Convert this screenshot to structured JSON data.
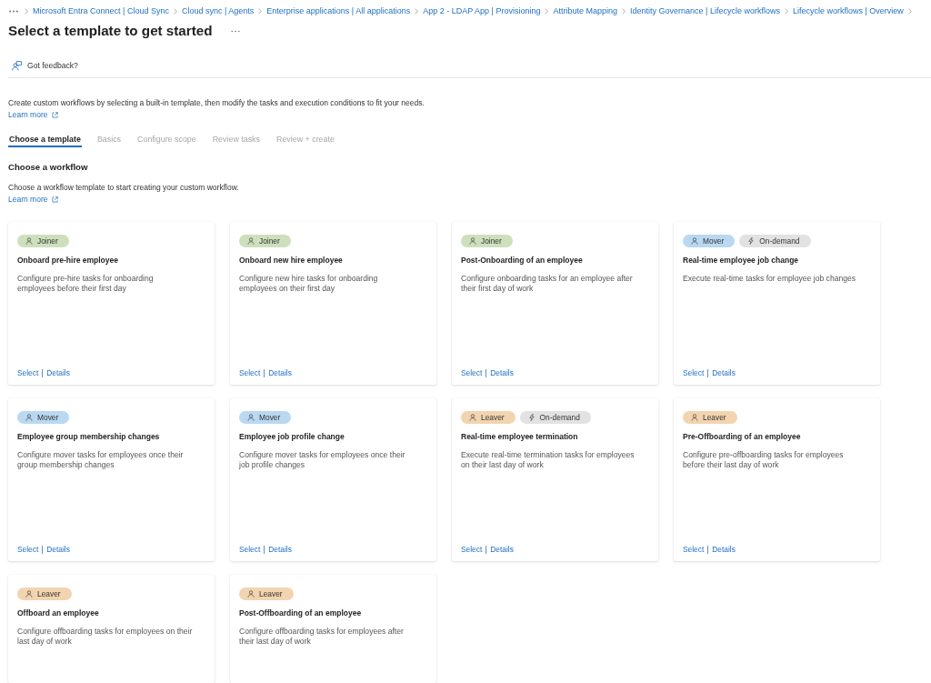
{
  "breadcrumb": {
    "items": [
      "Microsoft Entra Connect | Cloud Sync",
      "Cloud sync | Agents",
      "Enterprise applications | All applications",
      "App 2 - LDAP App | Provisioning",
      "Attribute Mapping",
      "Identity Governance | Lifecycle workflows",
      "Lifecycle workflows | Overview"
    ]
  },
  "header": {
    "title": "Select a template to get started"
  },
  "toolbar": {
    "feedback": "Got feedback?"
  },
  "intro": {
    "text": "Create custom workflows by selecting a built-in template, then modify the tasks and execution conditions to fit your needs.",
    "link": "Learn more"
  },
  "tabs": [
    {
      "label": "Choose a template",
      "selected": true
    },
    {
      "label": "Basics",
      "selected": false
    },
    {
      "label": "Configure scope",
      "selected": false
    },
    {
      "label": "Review tasks",
      "selected": false
    },
    {
      "label": "Review + create",
      "selected": false
    }
  ],
  "section": {
    "heading": "Choose a workflow",
    "text": "Choose a workflow template to start creating your custom workflow.",
    "link": "Learn more"
  },
  "cards": [
    {
      "tags": [
        {
          "label": "Joiner",
          "kind": "category",
          "color": "#cde0bd"
        }
      ],
      "title": "Onboard pre-hire employee",
      "description": "Configure pre-hire tasks for onboarding\nemployees before their first day",
      "actions": [
        "Select",
        "Details"
      ]
    },
    {
      "tags": [
        {
          "label": "Joiner",
          "kind": "category",
          "color": "#cde0bd"
        }
      ],
      "title": "Onboard new hire employee",
      "description": "Configure new hire tasks for onboarding\nemployees on their first day",
      "actions": [
        "Select",
        "Details"
      ]
    },
    {
      "tags": [
        {
          "label": "Joiner",
          "kind": "category",
          "color": "#cde0bd"
        }
      ],
      "title": "Post-Onboarding of an employee",
      "description": "Configure onboarding tasks for an employee after\ntheir first day of work",
      "actions": [
        "Select",
        "Details"
      ]
    },
    {
      "tags": [
        {
          "label": "Mover",
          "kind": "category",
          "color": "#b9d8f1"
        },
        {
          "label": "On-demand",
          "kind": "trigger",
          "color": "#e2e2e2"
        }
      ],
      "title": "Real-time employee job change",
      "description": "Execute real-time tasks for employee job changes",
      "actions": [
        "Select",
        "Details"
      ]
    },
    {
      "tags": [
        {
          "label": "Mover",
          "kind": "category",
          "color": "#b9d8f1"
        }
      ],
      "title": "Employee group membership changes",
      "description": "Configure mover tasks for employees once their\ngroup membership changes",
      "actions": [
        "Select",
        "Details"
      ]
    },
    {
      "tags": [
        {
          "label": "Mover",
          "kind": "category",
          "color": "#b9d8f1"
        }
      ],
      "title": "Employee job profile change",
      "description": "Configure mover tasks for employees once their\njob profile changes",
      "actions": [
        "Select",
        "Details"
      ]
    },
    {
      "tags": [
        {
          "label": "Leaver",
          "kind": "category",
          "color": "#f3d4b0"
        },
        {
          "label": "On-demand",
          "kind": "trigger",
          "color": "#e2e2e2"
        }
      ],
      "title": "Real-time employee termination",
      "description": "Execute real-time termination tasks for employees\non their last day of work",
      "actions": [
        "Select",
        "Details"
      ]
    },
    {
      "tags": [
        {
          "label": "Leaver",
          "kind": "category",
          "color": "#f3d4b0"
        }
      ],
      "title": "Pre-Offboarding of an employee",
      "description": "Configure pre-offboarding tasks for employees\nbefore their last day of work",
      "actions": [
        "Select",
        "Details"
      ]
    },
    {
      "tags": [
        {
          "label": "Leaver",
          "kind": "category",
          "color": "#f3d4b0"
        }
      ],
      "title": "Offboard an employee",
      "description": "Configure offboarding tasks for employees on their\nlast day of work"
    },
    {
      "tags": [
        {
          "label": "Leaver",
          "kind": "category",
          "color": "#f3d4b0"
        }
      ],
      "title": "Post-Offboarding of an employee",
      "description": "Configure offboarding tasks for employees after\ntheir last day of work"
    }
  ]
}
